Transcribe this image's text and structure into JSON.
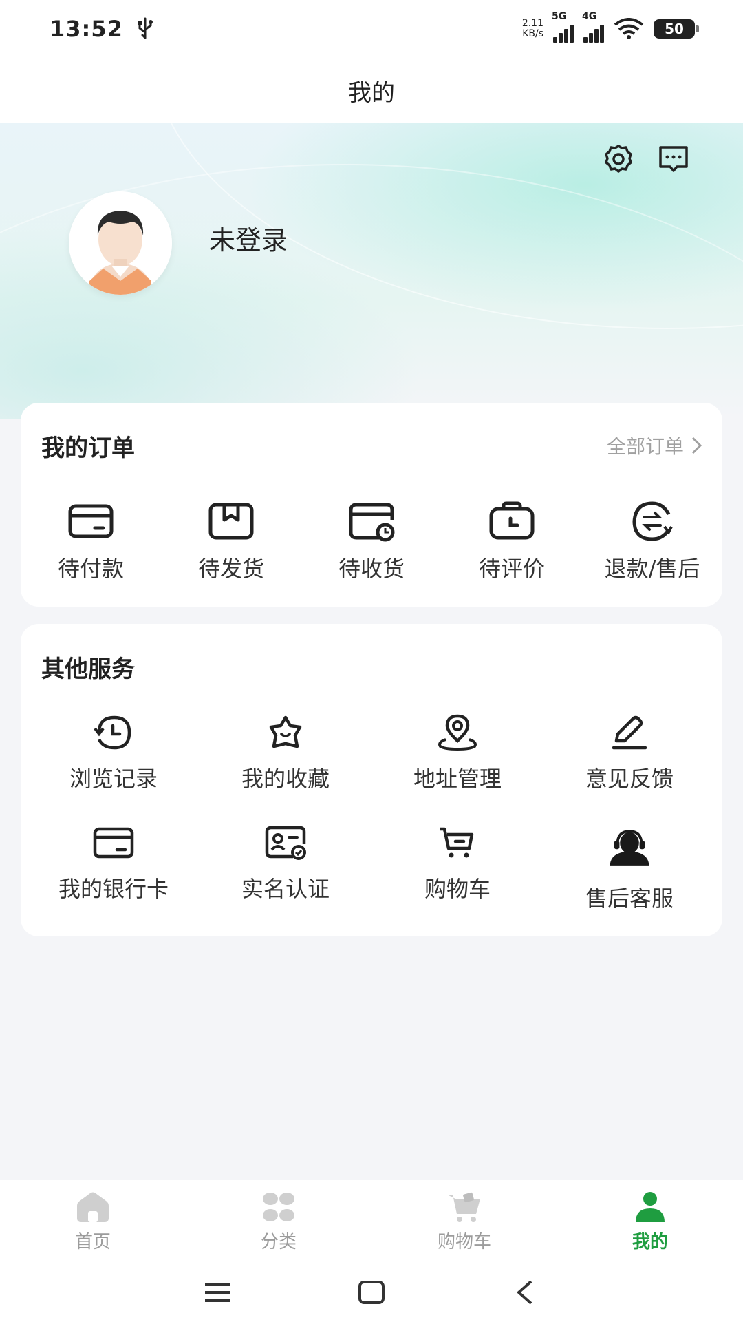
{
  "status_bar": {
    "time": "13:52",
    "net_speed_value": "2.11",
    "net_speed_unit": "KB/s",
    "signal_1": "5G",
    "signal_2": "4G",
    "battery": "50"
  },
  "title_bar": {
    "title": "我的"
  },
  "profile": {
    "login_status": "未登录"
  },
  "orders": {
    "title": "我的订单",
    "all_link": "全部订单",
    "items": [
      {
        "label": "待付款",
        "icon": "card-icon"
      },
      {
        "label": "待发货",
        "icon": "package-icon"
      },
      {
        "label": "待收货",
        "icon": "delivery-clock-icon"
      },
      {
        "label": "待评价",
        "icon": "bag-clock-icon"
      },
      {
        "label": "退款/售后",
        "icon": "refund-icon"
      }
    ]
  },
  "services": {
    "title": "其他服务",
    "items": [
      {
        "label": "浏览记录",
        "icon": "history-icon"
      },
      {
        "label": "我的收藏",
        "icon": "star-icon"
      },
      {
        "label": "地址管理",
        "icon": "location-icon"
      },
      {
        "label": "意见反馈",
        "icon": "edit-icon"
      },
      {
        "label": "我的银行卡",
        "icon": "bank-card-icon"
      },
      {
        "label": "实名认证",
        "icon": "id-card-icon"
      },
      {
        "label": "购物车",
        "icon": "cart-icon"
      },
      {
        "label": "售后客服",
        "icon": "customer-service-icon"
      }
    ]
  },
  "tabs": [
    {
      "label": "首页",
      "icon": "home-icon"
    },
    {
      "label": "分类",
      "icon": "category-icon"
    },
    {
      "label": "购物车",
      "icon": "cart-icon"
    },
    {
      "label": "我的",
      "icon": "user-icon",
      "active": true
    }
  ],
  "colors": {
    "accent": "#1f9d40",
    "inactive": "#9c9c9c"
  }
}
